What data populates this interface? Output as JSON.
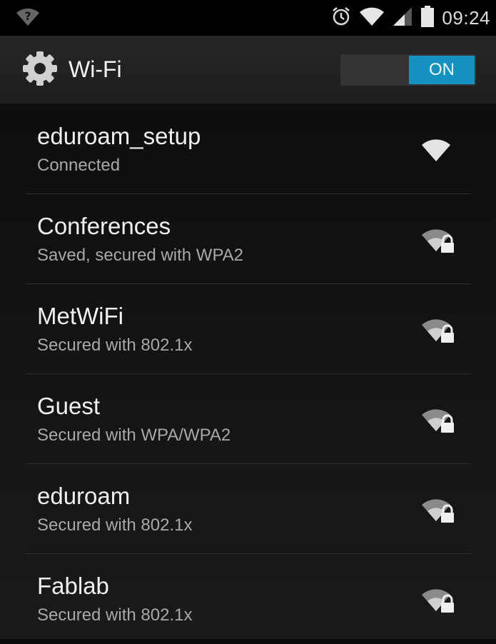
{
  "status_bar": {
    "icons": [
      "wifi-unknown-icon",
      "alarm-icon",
      "wifi-icon",
      "cell-signal-icon",
      "battery-icon"
    ],
    "time": "09:24"
  },
  "action_bar": {
    "icon": "gear-icon",
    "title": "Wi-Fi",
    "toggle_label": "ON",
    "accent_color": "#1591bf"
  },
  "networks": [
    {
      "name": "eduroam_setup",
      "status": "Connected",
      "icon": "wifi-full-icon",
      "secured": false
    },
    {
      "name": "Conferences",
      "status": "Saved, secured with WPA2",
      "icon": "wifi-lock-icon",
      "secured": true
    },
    {
      "name": "MetWiFi",
      "status": "Secured with 802.1x",
      "icon": "wifi-lock-icon",
      "secured": true
    },
    {
      "name": "Guest",
      "status": "Secured with WPA/WPA2",
      "icon": "wifi-lock-icon",
      "secured": true
    },
    {
      "name": "eduroam",
      "status": "Secured with 802.1x",
      "icon": "wifi-lock-icon",
      "secured": true
    },
    {
      "name": "Fablab",
      "status": "Secured with 802.1x",
      "icon": "wifi-lock-icon",
      "secured": true
    }
  ]
}
